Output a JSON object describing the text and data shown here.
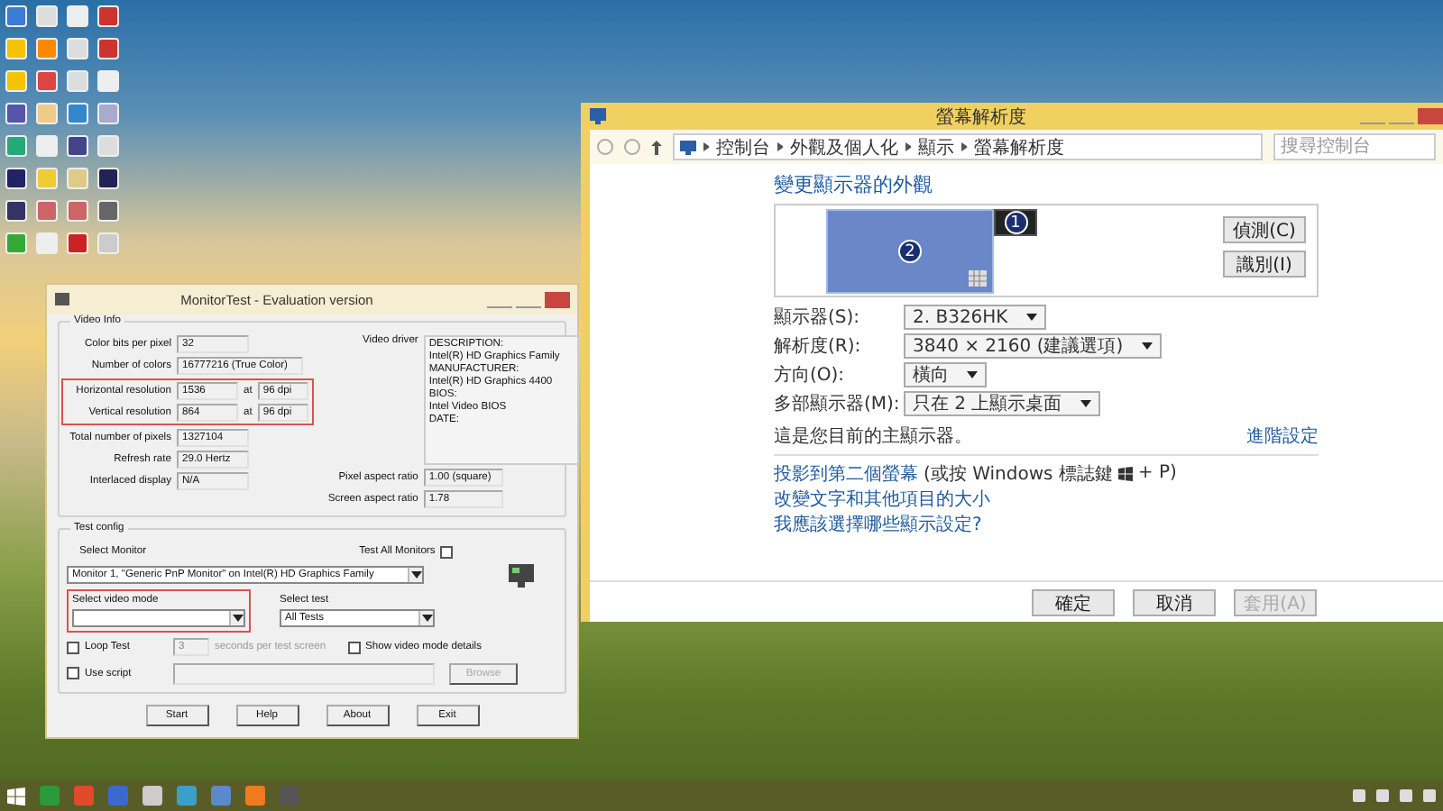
{
  "monitortest": {
    "title": "MonitorTest - Evaluation version",
    "video_info": {
      "title": "Video Info",
      "resolution_highlighted": true,
      "rows": [
        {
          "kind": "plain",
          "label": "Color bits per pixel",
          "value": "32"
        },
        {
          "kind": "wide",
          "label": "Number of colors",
          "value": "16777216 (True Color)"
        },
        {
          "kind": "resolution",
          "label": "Horizontal resolution",
          "value": "1536",
          "at": "at",
          "dpi": "96 dpi"
        },
        {
          "kind": "resolution",
          "label": "Vertical resolution",
          "value": "864",
          "at": "at",
          "dpi": "96 dpi"
        },
        {
          "kind": "plain",
          "label": "Total number of pixels",
          "value": "1327104"
        },
        {
          "kind": "plain",
          "label": "Refresh rate",
          "value": "29.0 Hertz"
        },
        {
          "kind": "plain",
          "label": "Interlaced display",
          "value": "N/A"
        }
      ],
      "driver": {
        "label": "Video driver",
        "lines": [
          "DESCRIPTION:",
          "Intel(R) HD Graphics Family",
          "MANUFACTURER:",
          "Intel(R) HD Graphics 4400",
          "BIOS:",
          "Intel Video BIOS",
          "DATE:"
        ]
      },
      "aspect_rows": [
        {
          "label": "Pixel aspect ratio",
          "value": "1.00 (square)"
        },
        {
          "label": "Screen aspect ratio",
          "value": "1.78"
        }
      ]
    },
    "test_config": {
      "title": "Test config",
      "select_monitor": {
        "label": "Select Monitor",
        "value": "Monitor 1, \"Generic PnP Monitor\" on Intel(R) HD Graphics Family"
      },
      "test_all": {
        "label": "Test All Monitors",
        "checked": false
      },
      "video_mode": {
        "label": "Select video mode",
        "highlighted": true
      },
      "select_test": {
        "label": "Select test",
        "value": "All Tests"
      },
      "loop_test": {
        "label": "Loop Test",
        "checked": false
      },
      "seconds": {
        "value": "3",
        "suffix": "seconds per test screen",
        "disabled": true
      },
      "show_details": {
        "label": "Show video mode details",
        "checked": false
      },
      "use_script": {
        "label": "Use script",
        "checked": false
      },
      "browse": {
        "label": "Browse",
        "disabled": true
      }
    },
    "buttons": [
      "Start",
      "Help",
      "About",
      "Exit"
    ]
  },
  "display": {
    "title": "螢幕解析度",
    "breadcrumb": [
      "控制台",
      "外觀及個人化",
      "顯示",
      "螢幕解析度"
    ],
    "search": {
      "placeholder": "搜尋控制台"
    },
    "heading": "變更顯示器的外觀",
    "monitors": [
      {
        "number": "2",
        "selected": true
      },
      {
        "number": "1",
        "selected": false
      }
    ],
    "side_buttons": [
      "偵測(C)",
      "識別(I)"
    ],
    "settings": [
      {
        "label": "顯示器(S):",
        "value": "2. B326HK"
      },
      {
        "label": "解析度(R):",
        "value": "3840 × 2160 (建議選項)"
      },
      {
        "label": "方向(O):",
        "value": "橫向"
      },
      {
        "label": "多部顯示器(M):",
        "value": "只在 2 上顯示桌面"
      }
    ],
    "primary_note": "這是您目前的主顯示器。",
    "advanced_link": "進階設定",
    "project_link": {
      "text": "投影到第二個螢幕",
      "hint_before": "(或按 Windows 標誌鍵",
      "hint_after": "+ P)"
    },
    "links": [
      "改變文字和其他項目的大小",
      "我應該選擇哪些顯示設定?"
    ],
    "buttons": [
      {
        "label": "確定",
        "disabled": false
      },
      {
        "label": "取消",
        "disabled": false
      },
      {
        "label": "套用(A)",
        "disabled": true
      }
    ]
  }
}
